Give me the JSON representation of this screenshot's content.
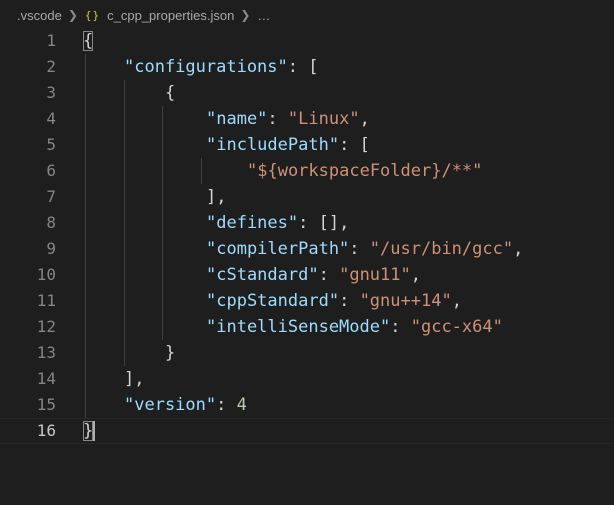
{
  "breadcrumb": {
    "folder": ".vscode",
    "file_icon": "{}",
    "file": "c_cpp_properties.json",
    "ellipsis": "…"
  },
  "editor": {
    "language": "json",
    "current_line": 16,
    "lines": [
      {
        "num": "1",
        "text": "{"
      },
      {
        "num": "2",
        "text": "    \"configurations\": ["
      },
      {
        "num": "3",
        "text": "        {"
      },
      {
        "num": "4",
        "text": "            \"name\": \"Linux\","
      },
      {
        "num": "5",
        "text": "            \"includePath\": ["
      },
      {
        "num": "6",
        "text": "                \"${workspaceFolder}/**\""
      },
      {
        "num": "7",
        "text": "            ],"
      },
      {
        "num": "8",
        "text": "            \"defines\": [],"
      },
      {
        "num": "9",
        "text": "            \"compilerPath\": \"/usr/bin/gcc\","
      },
      {
        "num": "10",
        "text": "            \"cStandard\": \"gnu11\","
      },
      {
        "num": "11",
        "text": "            \"cppStandard\": \"gnu++14\","
      },
      {
        "num": "12",
        "text": "            \"intelliSenseMode\": \"gcc-x64\""
      },
      {
        "num": "13",
        "text": "        }"
      },
      {
        "num": "14",
        "text": "    ],"
      },
      {
        "num": "15",
        "text": "    \"version\": 4"
      },
      {
        "num": "16",
        "text": "}"
      }
    ]
  },
  "colors": {
    "background": "#1e1e1e",
    "key": "#9cdcfe",
    "string": "#ce9178",
    "number": "#b5cea8",
    "punctuation": "#d4d4d4",
    "line_number": "#858585",
    "json_icon": "#cbcb41"
  }
}
